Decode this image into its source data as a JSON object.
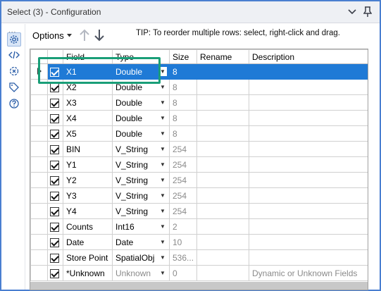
{
  "window": {
    "title": "Select (3) - Configuration"
  },
  "left_rail": {
    "dots": "...",
    "icons": [
      "gear-icon",
      "code-icon",
      "target-icon",
      "tag-icon",
      "help-icon"
    ]
  },
  "toolbar": {
    "options_label": "Options",
    "tip": "TIP: To reorder multiple rows: select, right-click and drag."
  },
  "table": {
    "headers": {
      "field": "Field",
      "type": "Type",
      "size": "Size",
      "rename": "Rename",
      "description": "Description"
    },
    "rows": [
      {
        "field": "X1",
        "type": "Double",
        "size": "8",
        "rename": "",
        "description": "",
        "selected": true
      },
      {
        "field": "X2",
        "type": "Double",
        "size": "8",
        "rename": "",
        "description": ""
      },
      {
        "field": "X3",
        "type": "Double",
        "size": "8",
        "rename": "",
        "description": ""
      },
      {
        "field": "X4",
        "type": "Double",
        "size": "8",
        "rename": "",
        "description": ""
      },
      {
        "field": "X5",
        "type": "Double",
        "size": "8",
        "rename": "",
        "description": ""
      },
      {
        "field": "BIN",
        "type": "V_String",
        "size": "254",
        "rename": "",
        "description": ""
      },
      {
        "field": "Y1",
        "type": "V_String",
        "size": "254",
        "rename": "",
        "description": ""
      },
      {
        "field": "Y2",
        "type": "V_String",
        "size": "254",
        "rename": "",
        "description": ""
      },
      {
        "field": "Y3",
        "type": "V_String",
        "size": "254",
        "rename": "",
        "description": ""
      },
      {
        "field": "Y4",
        "type": "V_String",
        "size": "254",
        "rename": "",
        "description": ""
      },
      {
        "field": "Counts",
        "type": "Int16",
        "size": "2",
        "rename": "",
        "description": ""
      },
      {
        "field": "Date",
        "type": "Date",
        "size": "10",
        "rename": "",
        "description": ""
      },
      {
        "field": "Store Point",
        "type": "SpatialObj",
        "size": "536...",
        "rename": "",
        "description": ""
      },
      {
        "field": "*Unknown",
        "type": "Unknown",
        "size": "0",
        "rename": "",
        "description": "Dynamic or Unknown Fields"
      }
    ]
  },
  "colors": {
    "selection": "#1f7ad6",
    "highlight_box": "#1a9e78",
    "frame_border": "#4a7fd0"
  }
}
